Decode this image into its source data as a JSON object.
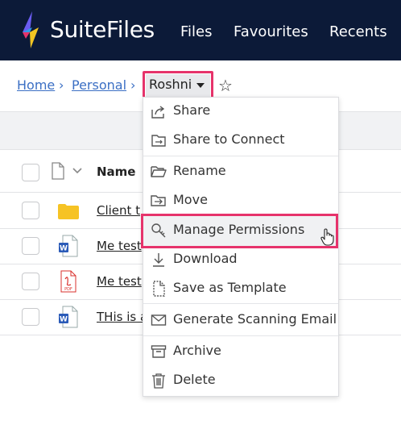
{
  "header": {
    "brand": "SuiteFiles",
    "nav": [
      "Files",
      "Favourites",
      "Recents"
    ]
  },
  "breadcrumb": {
    "home": "Home",
    "personal": "Personal",
    "current": "Roshni"
  },
  "table": {
    "name_header": "Name",
    "rows": [
      {
        "type": "folder",
        "name": "Client t"
      },
      {
        "type": "word",
        "name": "Me test"
      },
      {
        "type": "pdf",
        "name": "Me test"
      },
      {
        "type": "word",
        "name": "THis is a"
      }
    ]
  },
  "menu": {
    "items": [
      {
        "label": "Share",
        "icon": "share-icon"
      },
      {
        "label": "Share to Connect",
        "icon": "share-connect-icon"
      },
      {
        "label": "Rename",
        "icon": "folder-open-icon"
      },
      {
        "label": "Move",
        "icon": "move-icon"
      },
      {
        "label": "Manage Permissions",
        "icon": "key-icon"
      },
      {
        "label": "Download",
        "icon": "download-icon"
      },
      {
        "label": "Save as Template",
        "icon": "template-icon"
      },
      {
        "label": "Generate Scanning Email",
        "icon": "envelope-icon"
      },
      {
        "label": "Archive",
        "icon": "archive-icon"
      },
      {
        "label": "Delete",
        "icon": "trash-icon"
      }
    ],
    "highlighted": "Manage Permissions"
  },
  "colors": {
    "topbar": "#0c1a38",
    "link": "#3b6fc4",
    "highlight_border": "#e6336b",
    "folder": "#f6c324",
    "word": "#2b5bb8",
    "pdf": "#d9302c"
  }
}
